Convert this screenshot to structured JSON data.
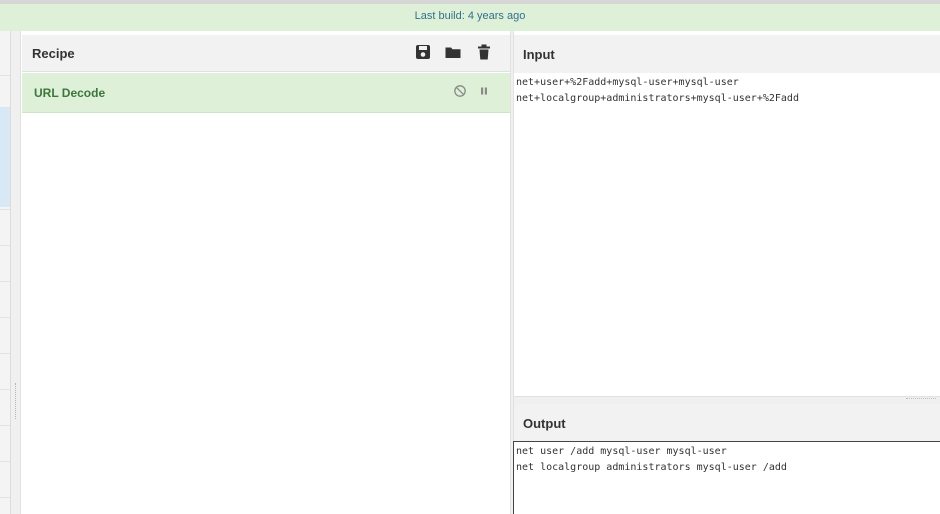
{
  "banner": {
    "text": "Last build: 4 years ago"
  },
  "recipe": {
    "title": "Recipe",
    "icons": [
      "save-icon",
      "folder-icon",
      "trash-icon"
    ],
    "operations": [
      {
        "name": "URL Decode",
        "icons": [
          "disable-icon",
          "pause-icon"
        ]
      }
    ]
  },
  "input": {
    "title": "Input",
    "text": "net+user+%2Fadd+mysql-user+mysql-user\nnet+localgroup+administrators+mysql-user+%2Fadd"
  },
  "output": {
    "title": "Output",
    "text": "net user /add mysql-user mysql-user\nnet localgroup administrators mysql-user /add"
  },
  "colors": {
    "banner_bg": "#dff0d8",
    "banner_text": "#31708f",
    "op_bg": "#dff0d8",
    "op_text": "#3c763d"
  }
}
